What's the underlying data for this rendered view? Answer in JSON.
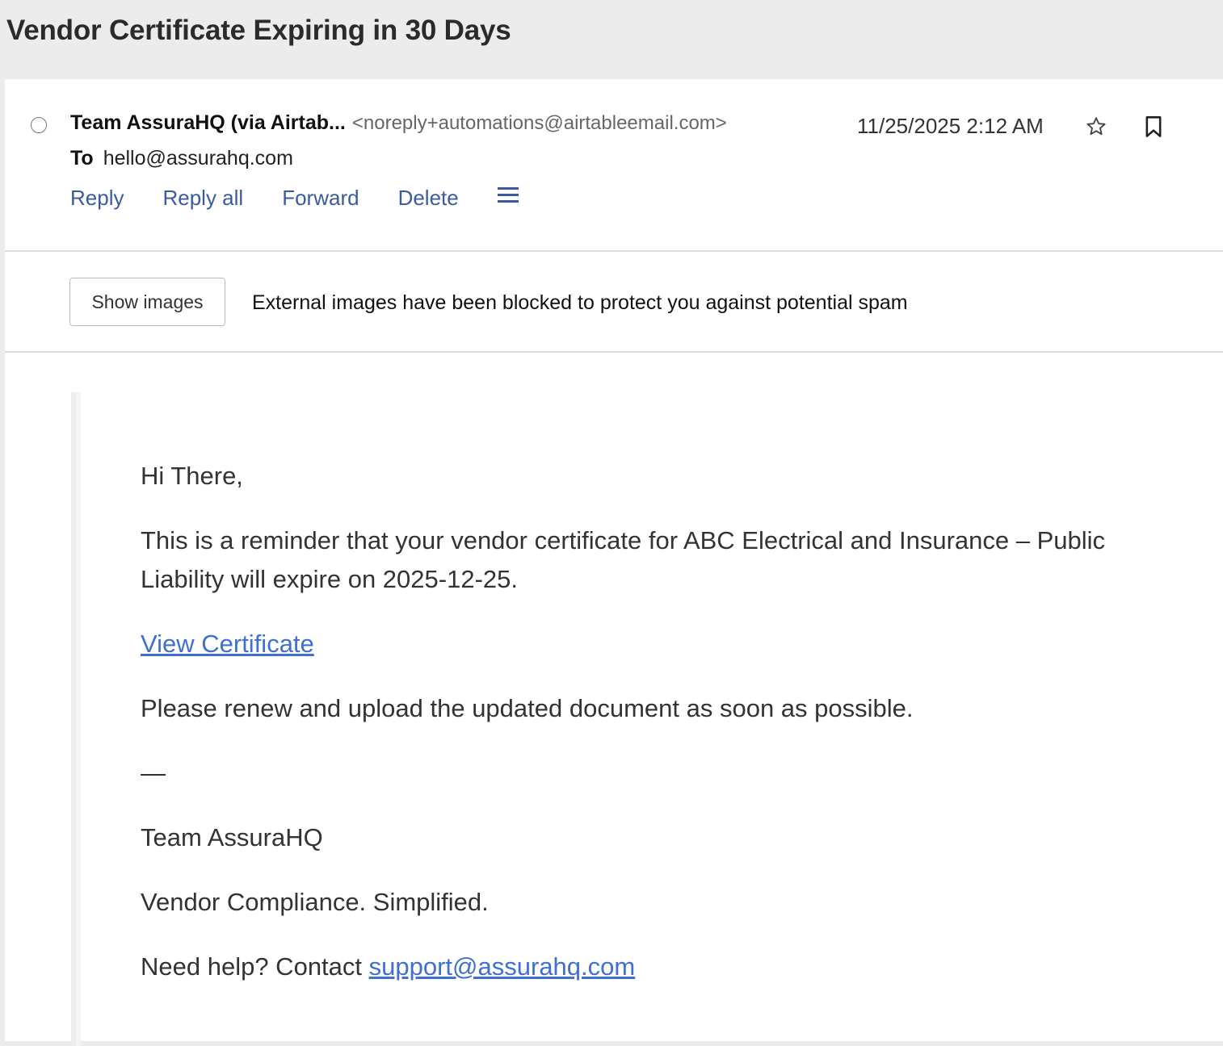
{
  "subject": "Vendor Certificate Expiring in 30 Days",
  "header": {
    "from_name": "Team AssuraHQ (via Airtab...",
    "from_address": "<noreply+automations@airtableemail.com>",
    "date": "11/25/2025 2:12 AM",
    "to_label": "To",
    "to_address": "hello@assurahq.com",
    "icons": {
      "star": "star-icon",
      "bookmark": "bookmark-icon",
      "menu": "menu-icon",
      "status": "unread-dot-icon"
    }
  },
  "actions": {
    "reply": "Reply",
    "reply_all": "Reply all",
    "forward": "Forward",
    "delete": "Delete"
  },
  "images_notice": {
    "button": "Show images",
    "message": "External images have been blocked to protect you against potential spam"
  },
  "body": {
    "greeting": "Hi There,",
    "reminder_line1": "This is a reminder that your vendor certificate for ABC Electrical and Insurance – Public",
    "reminder_line2": "Liability will expire on 2025-12-25.",
    "view_link": "View Certificate",
    "renew": "Please renew and upload the updated document as soon as possible.",
    "dash": "—",
    "signature_team": "Team AssuraHQ",
    "tagline": "Vendor Compliance. Simplified.",
    "help_prefix": "Need help? Contact ",
    "support_email": "support@assurahq.com"
  },
  "colors": {
    "link": "#3f6fd1",
    "action": "#3a5ba0",
    "background": "#ececec"
  }
}
